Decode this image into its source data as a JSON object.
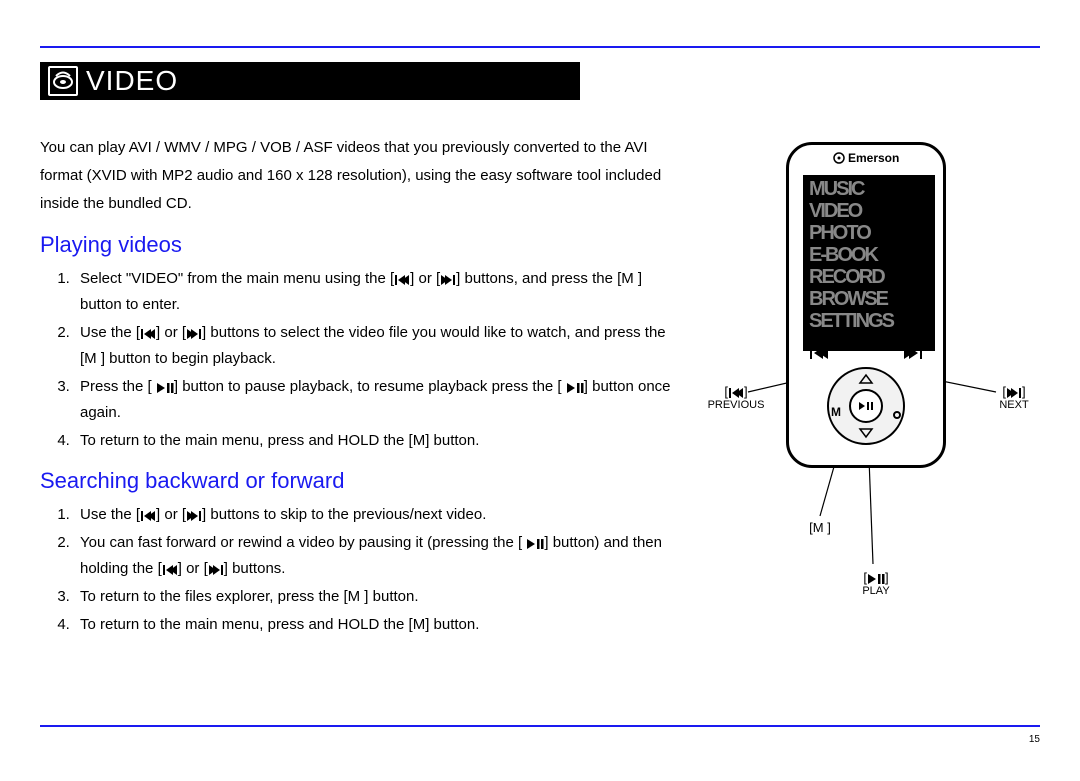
{
  "section_title": "VIDEO",
  "page_number": "15",
  "intro": "You can play AVI / WMV / MPG / VOB / ASF videos that you previously converted to the AVI format (XVID with MP2 audio and 160 x 128 resolution), using the easy software tool included inside the bundled CD.",
  "headings": {
    "playing": "Playing videos",
    "searching": "Searching backward or forward"
  },
  "playing_steps": {
    "s1a": "Select \"",
    "s1b": "VIDEO",
    "s1c": "\" from the main menu using the [",
    "s1d": "] or [",
    "s1e": "] buttons, and press the [",
    "s1f": "M",
    "s1g": " ] button to enter.",
    "s2a": "Use the [",
    "s2b": "] or [",
    "s2c": "] buttons to select the video file you would like to watch, and press the [",
    "s2d": "M",
    "s2e": " ] button to begin playback.",
    "s3a": "Press the [ ",
    "s3b": "] button to pause playback, to resume playback press the [ ",
    "s3c": "] button once again.",
    "s4a": "To return to the main menu, press and ",
    "s4b": "HOLD",
    "s4c": " the [",
    "s4d": "M",
    "s4e": "]   button."
  },
  "searching_steps": {
    "s1a": "Use the [",
    "s1b": "] or [",
    "s1c": "] buttons to skip to the previous/next video.",
    "s2a": "You can fast forward or rewind a video by pausing it (pressing the [ ",
    "s2b": "] button) and then holding the [",
    "s2c": "] or [",
    "s2d": "] buttons.",
    "s3a": "To return to the files explorer, press the [",
    "s3b": "M",
    "s3c": " ] button.",
    "s4a": "To return to the main menu, press and ",
    "s4b": "HOLD",
    "s4c": " the [",
    "s4d": "M",
    "s4e": "]   button."
  },
  "device": {
    "brand": "Emerson",
    "menu_items": [
      "MUSIC",
      "VIDEO",
      "PHOTO",
      "E-BOOK",
      "RECORD",
      "BROWSE",
      "SETTINGS"
    ]
  },
  "annotations": {
    "previous_btn": "[⏮]",
    "previous_label": "PREVIOUS",
    "next_btn": "[⏭]",
    "next_label": "NEXT",
    "m_btn": "[M ]",
    "play_btn": "[▶❙❙]",
    "play_label": "PLAY"
  },
  "icons": {
    "prev": "previous-track-icon",
    "next": "next-track-icon",
    "playpause": "play-pause-icon",
    "video_section": "video-disc-icon"
  }
}
